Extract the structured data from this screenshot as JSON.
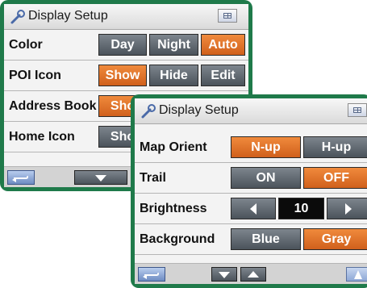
{
  "back_panel": {
    "title": "Display Setup",
    "rows": [
      {
        "label": "Color",
        "buttons": [
          "Day",
          "Night",
          "Auto"
        ]
      },
      {
        "label": "POI Icon",
        "buttons": [
          "Show",
          "Hide",
          "Edit"
        ]
      },
      {
        "label": "Address Book",
        "buttons": [
          "Sho"
        ]
      },
      {
        "label": "Home Icon",
        "buttons": [
          "Sho"
        ]
      }
    ]
  },
  "front_panel": {
    "title": "Display Setup",
    "rows": [
      {
        "label": "Map Orient",
        "buttons": [
          "N-up",
          "H-up"
        ]
      },
      {
        "label": "Trail",
        "buttons": [
          "ON",
          "OFF"
        ]
      },
      {
        "label": "Brightness",
        "value": "10"
      },
      {
        "label": "Background",
        "buttons": [
          "Blue",
          "Gray"
        ]
      }
    ]
  },
  "colors": {
    "frame": "#1f7a4a",
    "selected": "#e0702a",
    "unselected": "#5f676f",
    "value_box": "#0b0b0b"
  },
  "icons": [
    "wrench-icon",
    "menu-icon",
    "back-icon",
    "scroll-down-icon",
    "scroll-up-icon",
    "decrease-icon",
    "increase-icon",
    "compass-icon"
  ]
}
